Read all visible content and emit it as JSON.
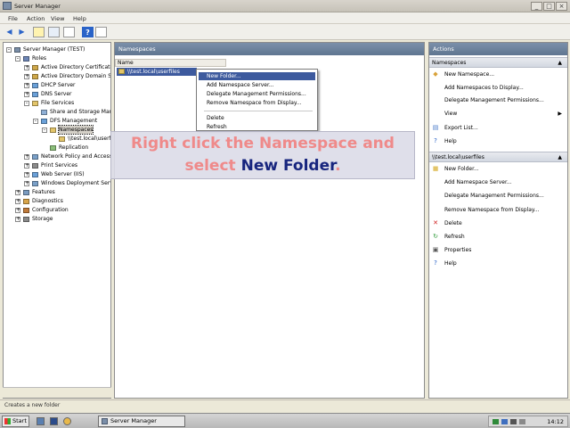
{
  "window": {
    "title": "Server Manager"
  },
  "menu": [
    "File",
    "Action",
    "View",
    "Help"
  ],
  "tree": [
    {
      "label": "Server Manager (TEST)",
      "level": 0,
      "exp": "-"
    },
    {
      "label": "Roles",
      "level": 1,
      "exp": "-"
    },
    {
      "label": "Active Directory Certificate",
      "level": 2,
      "exp": "+"
    },
    {
      "label": "Active Directory Domain Se",
      "level": 2,
      "exp": "+"
    },
    {
      "label": "DHCP Server",
      "level": 2,
      "exp": "+"
    },
    {
      "label": "DNS Server",
      "level": 2,
      "exp": "+"
    },
    {
      "label": "File Services",
      "level": 2,
      "exp": "-"
    },
    {
      "label": "Share and Storage Mar",
      "level": 3,
      "exp": ""
    },
    {
      "label": "DFS Management",
      "level": 3,
      "exp": "-"
    },
    {
      "label": "Namespaces",
      "level": 4,
      "exp": "-",
      "selected": true
    },
    {
      "label": "\\\\test.local\\userfiles",
      "level": 5,
      "exp": ""
    },
    {
      "label": "Replication",
      "level": 4,
      "exp": ""
    },
    {
      "label": "Network Policy and Access",
      "level": 2,
      "exp": "+"
    },
    {
      "label": "Print Services",
      "level": 2,
      "exp": "+"
    },
    {
      "label": "Web Server (IIS)",
      "level": 2,
      "exp": "+"
    },
    {
      "label": "Windows Deployment Servi",
      "level": 2,
      "exp": "+"
    },
    {
      "label": "Features",
      "level": 1,
      "exp": "+"
    },
    {
      "label": "Diagnostics",
      "level": 1,
      "exp": "+"
    },
    {
      "label": "Configuration",
      "level": 1,
      "exp": "+"
    },
    {
      "label": "Storage",
      "level": 1,
      "exp": "+"
    }
  ],
  "center": {
    "title": "Namespaces",
    "column_header": "Name",
    "rows": [
      "\\\\test.local\\userfiles"
    ]
  },
  "context_menu": [
    {
      "label": "New Folder...",
      "highlighted": true
    },
    {
      "label": "Add Namespace Server..."
    },
    {
      "label": "Delegate Management Permissions..."
    },
    {
      "label": "Remove Namespace from Display..."
    },
    {
      "label": "Delete"
    },
    {
      "label": "Refresh"
    }
  ],
  "callout": {
    "line1": "Right click the Namespace and",
    "line2_pre": "select ",
    "line2_em": "New Folder",
    "line2_post": "."
  },
  "actions": {
    "title": "Actions",
    "sections": [
      {
        "header": "Namespaces",
        "items": [
          {
            "label": "New Namespace...",
            "icon": "new-namespace-icon"
          },
          {
            "label": "Add Namespaces to Display...",
            "icon": ""
          },
          {
            "label": "Delegate Management Permissions...",
            "icon": ""
          },
          {
            "label": "View",
            "icon": "",
            "submenu": true
          },
          {
            "label": "Export List...",
            "icon": "export-icon"
          },
          {
            "label": "Help",
            "icon": "help-icon"
          }
        ]
      },
      {
        "header": "\\\\test.local\\userfiles",
        "items": [
          {
            "label": "New Folder...",
            "icon": "new-folder-icon"
          },
          {
            "label": "Add Namespace Server...",
            "icon": ""
          },
          {
            "label": "Delegate Management Permissions...",
            "icon": ""
          },
          {
            "label": "Remove Namespace from Display...",
            "icon": ""
          },
          {
            "label": "Delete",
            "icon": "delete-icon"
          },
          {
            "label": "Refresh",
            "icon": "refresh-icon"
          },
          {
            "label": "Properties",
            "icon": "properties-icon"
          },
          {
            "label": "Help",
            "icon": "help-icon"
          }
        ]
      }
    ]
  },
  "status": "Creates a new folder",
  "taskbar": {
    "start": "Start",
    "task": "Server Manager",
    "clock": "14:12"
  },
  "colors": {
    "selection": "#3d5a9e",
    "callout_text": "#ef8a8a",
    "callout_emphasis": "#17257e"
  }
}
